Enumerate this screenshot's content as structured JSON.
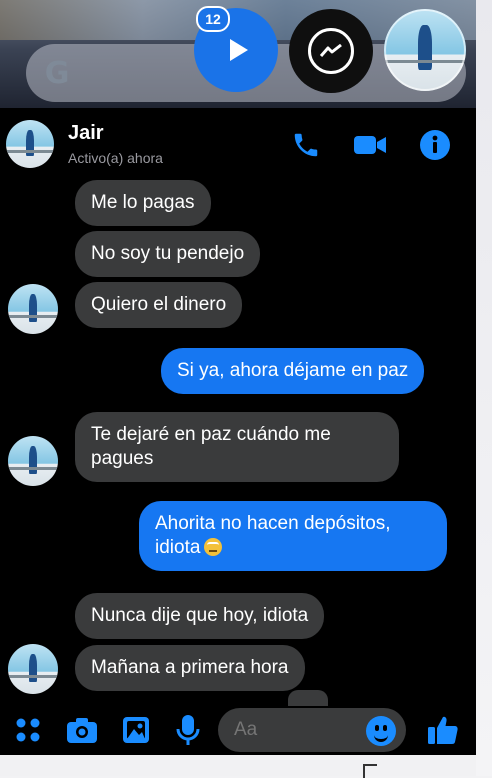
{
  "overlay": {
    "video_badge_count": "12",
    "google_logo": "G"
  },
  "header": {
    "contact_name": "Jair",
    "status": "Activo(a) ahora"
  },
  "messages": [
    {
      "side": "in",
      "text": "Me lo pagas"
    },
    {
      "side": "in",
      "text": "No soy tu pendejo"
    },
    {
      "side": "in",
      "text": "Quiero el dinero"
    },
    {
      "side": "out",
      "text": "Si ya, ahora déjame en paz"
    },
    {
      "side": "in",
      "text_line1": "Te dejaré en paz cuándo me",
      "text_line2": "pagues"
    },
    {
      "side": "out",
      "text_line1": "Ahorita no hacen depósitos,",
      "text_line2": "idiota"
    },
    {
      "side": "in",
      "text": "Nunca dije que hoy, idiota"
    },
    {
      "side": "in",
      "text": "Mañana a primera hora"
    }
  ],
  "composer": {
    "placeholder": "Aa"
  },
  "colors": {
    "accent": "#1677f2",
    "incoming_bubble": "#3a3b3c",
    "background": "#000000"
  }
}
